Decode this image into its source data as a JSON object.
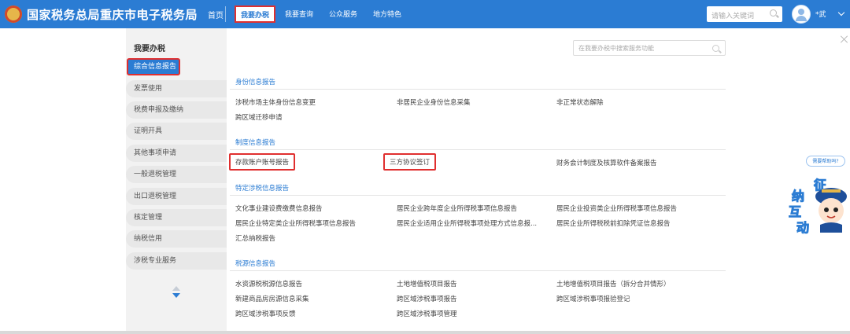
{
  "header": {
    "site_title": "国家税务总局重庆市电子税务局",
    "nav": {
      "home": "首页",
      "items": [
        "我要办税",
        "我要查询",
        "公众服务",
        "地方特色"
      ]
    },
    "search_placeholder": "请输入关键词",
    "user_name": "*武"
  },
  "sidebar": {
    "title": "我要办税",
    "items": [
      "综合信息报告",
      "发票使用",
      "税费申报及缴纳",
      "证明开具",
      "其他事项申请",
      "一般退税管理",
      "出口退税管理",
      "核定管理",
      "纳税信用",
      "涉税专业服务"
    ]
  },
  "main": {
    "search_placeholder": "在我要办税中搜索服务功能",
    "sections": [
      {
        "title": "身份信息报告",
        "links": [
          "涉税市场主体身份信息变更",
          "非居民企业身份信息采集",
          "非正常状态解除",
          "跨区域迁移申请"
        ]
      },
      {
        "title": "制度信息报告",
        "links": [
          "存款账户账号报告",
          "三方协议签订",
          "财务会计制度及核算软件备案报告"
        ]
      },
      {
        "title": "特定涉税信息报告",
        "links": [
          "文化事业建设费缴费信息报告",
          "居民企业跨年度企业所得税事项信息报告",
          "居民企业投资类企业所得税事项信息报告",
          "居民企业特定类企业所得税事项信息报告",
          "居民企业适用企业所得税事项处理方式信息报...",
          "居民企业所得税税前扣除凭证信息报告",
          "汇总纳税报告"
        ]
      },
      {
        "title": "税源信息报告",
        "links": [
          "水资源税税源信息报告",
          "土地增值税项目报告",
          "土地增值税项目报告（拆分合并情形）",
          "新建商品房房源信息采集",
          "跨区域涉税事项报告",
          "跨区域涉税事项报验登记",
          "跨区域涉税事项反馈",
          "跨区域涉税事项管理"
        ]
      }
    ]
  },
  "help": {
    "bubble": "需要帮助吗?",
    "chars": [
      "征",
      "纳",
      "互",
      "动"
    ]
  },
  "colors": {
    "brand_blue": "#2b7cd3",
    "highlight_red": "#e02f2f",
    "sidebar_bg": "#f2f2f2"
  },
  "icons": [
    "emblem-logo",
    "search-icon",
    "avatar-icon",
    "chevron-down-icon",
    "arrow-up-icon",
    "arrow-down-icon",
    "close-icon",
    "mascot-icon"
  ]
}
